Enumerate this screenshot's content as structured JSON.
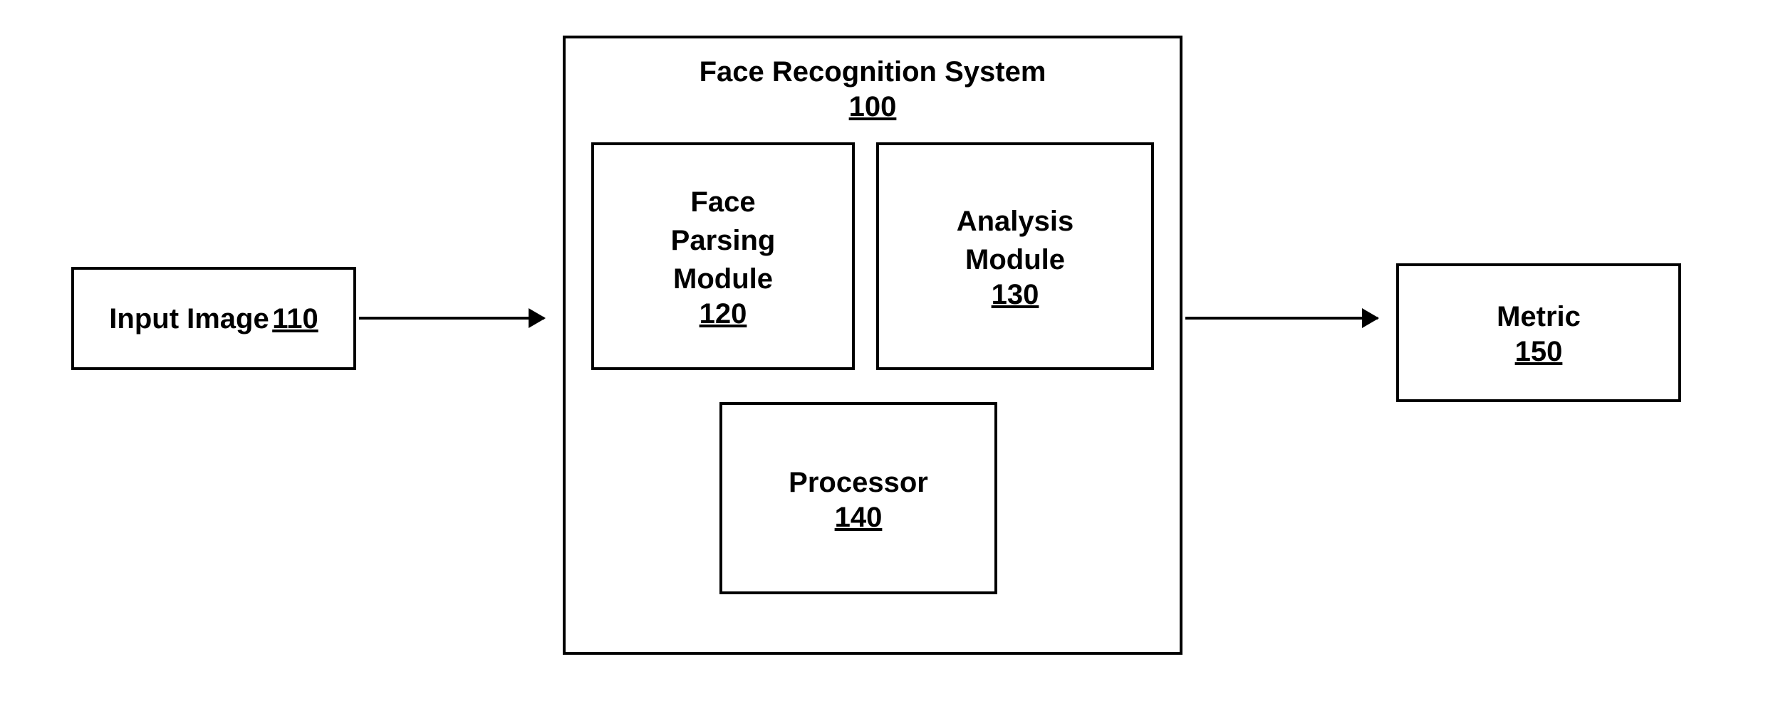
{
  "input": {
    "label": "Input Image",
    "number": "110"
  },
  "system": {
    "title": "Face Recognition System",
    "number": "100",
    "modules": {
      "parsing": {
        "label": "Face\nParsing\nModule",
        "number": "120"
      },
      "analysis": {
        "label": "Analysis\nModule",
        "number": "130"
      },
      "processor": {
        "label": "Processor",
        "number": "140"
      }
    }
  },
  "output": {
    "label": "Metric",
    "number": "150"
  }
}
